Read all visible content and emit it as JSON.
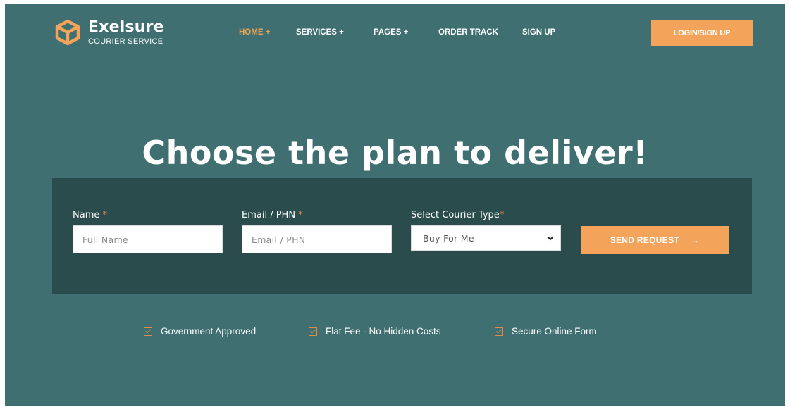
{
  "brand": {
    "name": "Exelsure",
    "tagline": "COURIER SERVICE",
    "icon": "box-logo-icon",
    "accent": "#f4a45a"
  },
  "nav": {
    "items": [
      {
        "label": "HOME +"
      },
      {
        "label": "SERVICES +"
      },
      {
        "label": "PAGES +"
      },
      {
        "label": "ORDER TRACK"
      },
      {
        "label": "SIGN UP"
      }
    ],
    "login_label": "LOGIN/SIGN UP"
  },
  "hero": {
    "title": "Choose the plan to deliver!"
  },
  "form": {
    "name_label": "Name",
    "name_placeholder": "Full Name",
    "email_label": "Email / PHN",
    "email_placeholder": "Email / PHN",
    "type_label": "Select Courier Type",
    "type_selected": "Buy For Me",
    "required_mark": "*",
    "submit_label": "SEND REQUEST",
    "submit_arrow": "→"
  },
  "features": [
    {
      "label": "Government Approved",
      "icon": "checkbox-icon"
    },
    {
      "label": "Flat Fee - No Hidden Costs",
      "icon": "checkbox-icon"
    },
    {
      "label": "Secure Online Form",
      "icon": "checkbox-icon"
    }
  ],
  "colors": {
    "background": "#3f6f70",
    "panel": "#2a4c4d",
    "active_nav": "#f0a556"
  }
}
